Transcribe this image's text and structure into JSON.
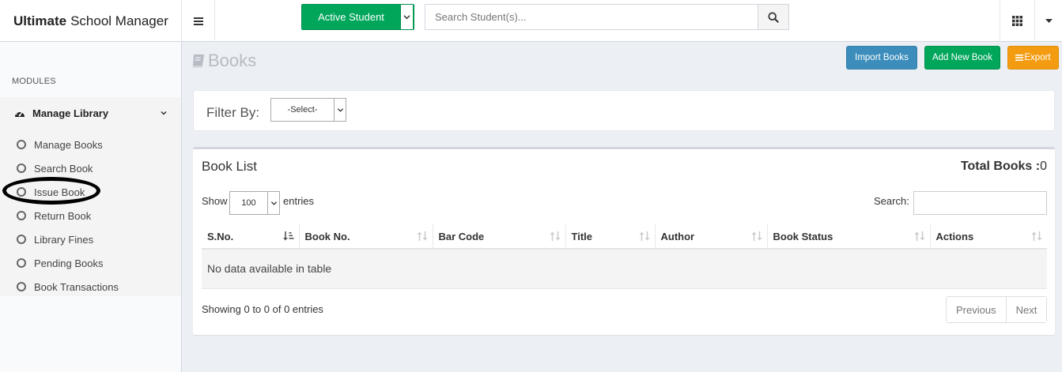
{
  "app": {
    "brand_bold": "Ultimate",
    "brand_rest": "School Manager"
  },
  "header": {
    "active_student_label": "Active Student",
    "search_placeholder": "Search Student(s)...",
    "icons": [
      "hamburger-icon",
      "search-icon",
      "grid-icon",
      "caret-down-icon"
    ]
  },
  "sidebar": {
    "section_label": "MODULES",
    "group": {
      "label": "Manage Library",
      "icon": "dashboard-icon",
      "expanded": true
    },
    "items": [
      {
        "label": "Manage Books"
      },
      {
        "label": "Search Book"
      },
      {
        "label": "Issue Book"
      },
      {
        "label": "Return Book"
      },
      {
        "label": "Library Fines"
      },
      {
        "label": "Pending Books"
      },
      {
        "label": "Book Transactions"
      }
    ]
  },
  "page": {
    "title": "Books",
    "buttons": {
      "import": "Import Books",
      "add": "Add New Book",
      "export": "Export"
    }
  },
  "filter": {
    "label": "Filter By:",
    "selected": "-Select-"
  },
  "book_list": {
    "title": "Book List",
    "total_label": "Total Books :",
    "total_value": "0",
    "show_label": "Show",
    "page_length": "100",
    "entries_label": "entries",
    "search_label": "Search:",
    "columns": [
      "S.No.",
      "Book No.",
      "Bar Code",
      "Title",
      "Author",
      "Book Status",
      "Actions"
    ],
    "empty_message": "No data available in table",
    "info": "Showing 0 to 0 of 0 entries",
    "pagination": {
      "previous": "Previous",
      "next": "Next"
    }
  },
  "colors": {
    "green": "#00a65a",
    "blue": "#3c8dbc",
    "orange": "#f39c12",
    "annotation": "#000000"
  }
}
